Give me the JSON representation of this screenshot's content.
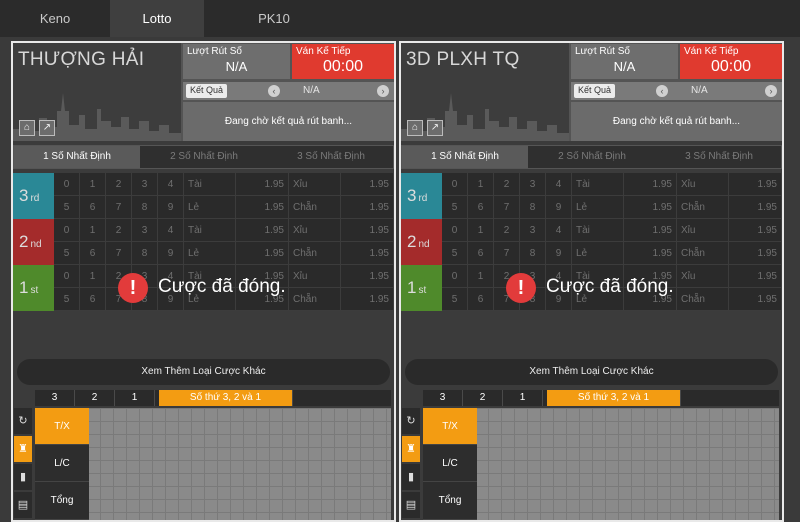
{
  "tabs": [
    {
      "label": "Keno"
    },
    {
      "label": "Lotto",
      "active": true
    },
    {
      "label": "PK10"
    }
  ],
  "panels": [
    {
      "city": "THƯỢNG HẢI",
      "draw_label": "Lượt Rút Số",
      "draw_value": "N/A",
      "next_label": "Ván Kế Tiếp",
      "next_value": "00:00",
      "result_button": "Kết Quả",
      "result_value": "N/A",
      "result_wait": "Đang chờ kết quả rút banh...",
      "subtabs": [
        "1 Số Nhất Định",
        "2 Số Nhất Định",
        "3 Số Nhất Định"
      ],
      "closed_text": "Cược đã đóng.",
      "more_button": "Xem Thêm Loại Cược Khác",
      "lower_tabs": [
        "3",
        "2",
        "1",
        "Số thứ 3, 2 và 1"
      ],
      "board_labels": [
        "T/X",
        "L/C",
        "Tổng"
      ]
    },
    {
      "city": "3D PLXH TQ",
      "draw_label": "Lượt Rút Số",
      "draw_value": "N/A",
      "next_label": "Ván Kế Tiếp",
      "next_value": "00:00",
      "result_button": "Kết Quả",
      "result_value": "N/A",
      "result_wait": "Đang chờ kết quả rút banh...",
      "subtabs": [
        "1 Số Nhất Định",
        "2 Số Nhất Định",
        "3 Số Nhất Định"
      ],
      "closed_text": "Cược đã đóng.",
      "more_button": "Xem Thêm Loại Cược Khác",
      "lower_tabs": [
        "3",
        "2",
        "1",
        "Số thứ 3, 2 và 1"
      ],
      "board_labels": [
        "T/X",
        "L/C",
        "Tổng"
      ]
    }
  ],
  "grid": {
    "ranks": [
      {
        "num": "3",
        "suffix": "rd",
        "color": "#2a8896"
      },
      {
        "num": "2",
        "suffix": "nd",
        "color": "#a42b2b"
      },
      {
        "num": "1",
        "suffix": "st",
        "color": "#4f8a2b"
      }
    ],
    "row_numbers": [
      [
        "0",
        "1",
        "2",
        "3",
        "4"
      ],
      [
        "5",
        "6",
        "7",
        "8",
        "9"
      ]
    ],
    "bets": [
      [
        {
          "label": "Tài",
          "odds": "1.95"
        },
        {
          "label": "Xỉu",
          "odds": "1.95"
        }
      ],
      [
        {
          "label": "Lẻ",
          "odds": "1.95"
        },
        {
          "label": "Chẵn",
          "odds": "1.95"
        }
      ]
    ]
  },
  "icons": {
    "home": "home-icon",
    "popout": "popout-icon",
    "refresh": "refresh-icon",
    "trophy": "trophy-icon",
    "chart": "chart-icon",
    "doc": "document-icon"
  },
  "colors": {
    "accent": "#f39c12",
    "next_game": "#e03a2f",
    "closed": "#e23b3b"
  }
}
